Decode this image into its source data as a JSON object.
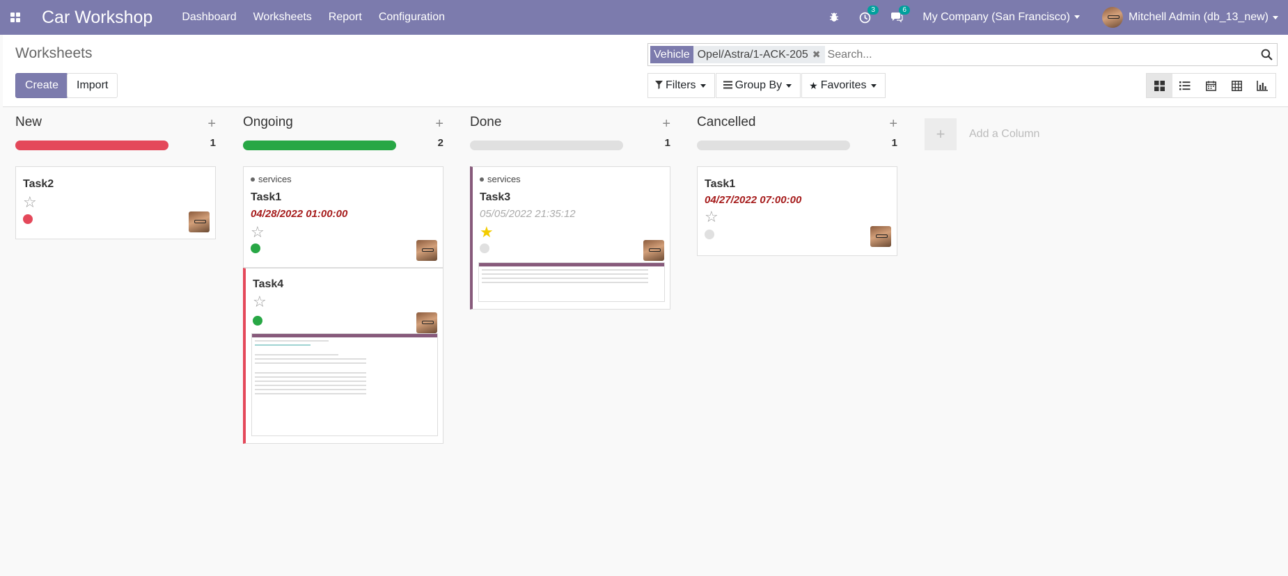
{
  "navbar": {
    "app_title": "Car Workshop",
    "menu": [
      "Dashboard",
      "Worksheets",
      "Report",
      "Configuration"
    ],
    "activity_count": "3",
    "messages_count": "6",
    "company": "My Company (San Francisco)",
    "user": "Mitchell Admin (db_13_new)"
  },
  "control": {
    "breadcrumb": "Worksheets",
    "create_label": "Create",
    "import_label": "Import",
    "search": {
      "facet_category": "Vehicle",
      "facet_value": "Opel/Astra/1-ACK-205",
      "placeholder": "Search..."
    },
    "filters_label": "Filters",
    "groupby_label": "Group By",
    "favorites_label": "Favorites"
  },
  "kanban": {
    "columns": [
      {
        "title": "New",
        "count": "1"
      },
      {
        "title": "Ongoing",
        "count": "2"
      },
      {
        "title": "Done",
        "count": "1"
      },
      {
        "title": "Cancelled",
        "count": "1"
      }
    ],
    "add_column_label": "Add a Column",
    "cards": {
      "new_task2": {
        "title": "Task2"
      },
      "ongoing_task1": {
        "tag": "services",
        "title": "Task1",
        "date": "04/28/2022 01:00:00"
      },
      "ongoing_task4": {
        "title": "Task4"
      },
      "done_task3": {
        "tag": "services",
        "title": "Task3",
        "date": "05/05/2022 21:35:12"
      },
      "cancelled_task1": {
        "title": "Task1",
        "date": "04/27/2022 07:00:00"
      }
    }
  },
  "colors": {
    "brand": "#7c7bad",
    "danger": "#e4485a",
    "success": "#28a745",
    "muted": "#e0e0e0",
    "deadline": "#a51a1a",
    "star": "#f3cc00"
  }
}
